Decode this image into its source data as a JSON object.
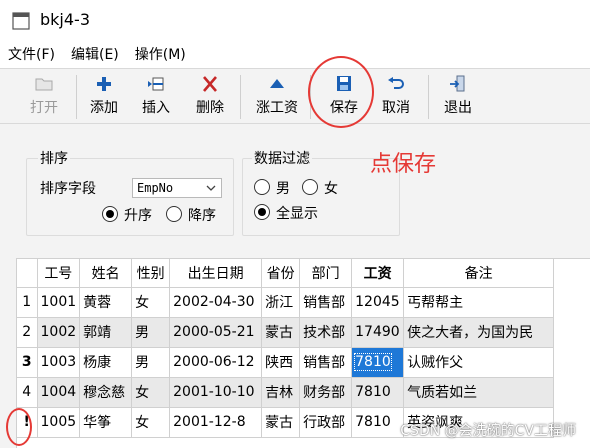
{
  "window": {
    "title": "bkj4-3"
  },
  "menubar": [
    "文件(F)",
    "编辑(E)",
    "操作(M)"
  ],
  "toolbar": {
    "open": "打开",
    "add": "添加",
    "insert": "插入",
    "delete": "删除",
    "raise": "涨工资",
    "save": "保存",
    "cancel": "取消",
    "exit": "退出"
  },
  "sort_group": {
    "title": "排序",
    "field_label": "排序字段",
    "field_value": "EmpNo",
    "asc": "升序",
    "desc": "降序",
    "selected": "升序"
  },
  "filter_group": {
    "title": "数据过滤",
    "male": "男",
    "female": "女",
    "all": "全显示",
    "selected": "全显示"
  },
  "annotation": "点保存",
  "table": {
    "columns": [
      "工号",
      "姓名",
      "性别",
      "出生日期",
      "省份",
      "部门",
      "工资",
      "备注"
    ],
    "row_headers": [
      "1",
      "2",
      "3",
      "4",
      "!"
    ],
    "rows": [
      [
        "1001",
        "黄蓉",
        "女",
        "2002-04-30",
        "浙江",
        "销售部",
        "12045",
        "丐帮帮主"
      ],
      [
        "1002",
        "郭靖",
        "男",
        "2000-05-21",
        "蒙古",
        "技术部",
        "17490",
        "侠之大者，为国为民"
      ],
      [
        "1003",
        "杨康",
        "男",
        "2000-06-12",
        "陕西",
        "销售部",
        "7810",
        "认贼作父"
      ],
      [
        "1004",
        "穆念慈",
        "女",
        "2001-10-10",
        "吉林",
        "财务部",
        "7810",
        "气质若如兰"
      ],
      [
        "1005",
        "华筝",
        "女",
        "2001-12-8",
        "蒙古",
        "行政部",
        "7810",
        "英姿飒爽"
      ]
    ]
  },
  "watermark": "CSDN @会洗碗的CV工程师",
  "colors": {
    "accent": "#1e78d7",
    "annotation": "#e53935",
    "panel": "#f3f3f3"
  }
}
